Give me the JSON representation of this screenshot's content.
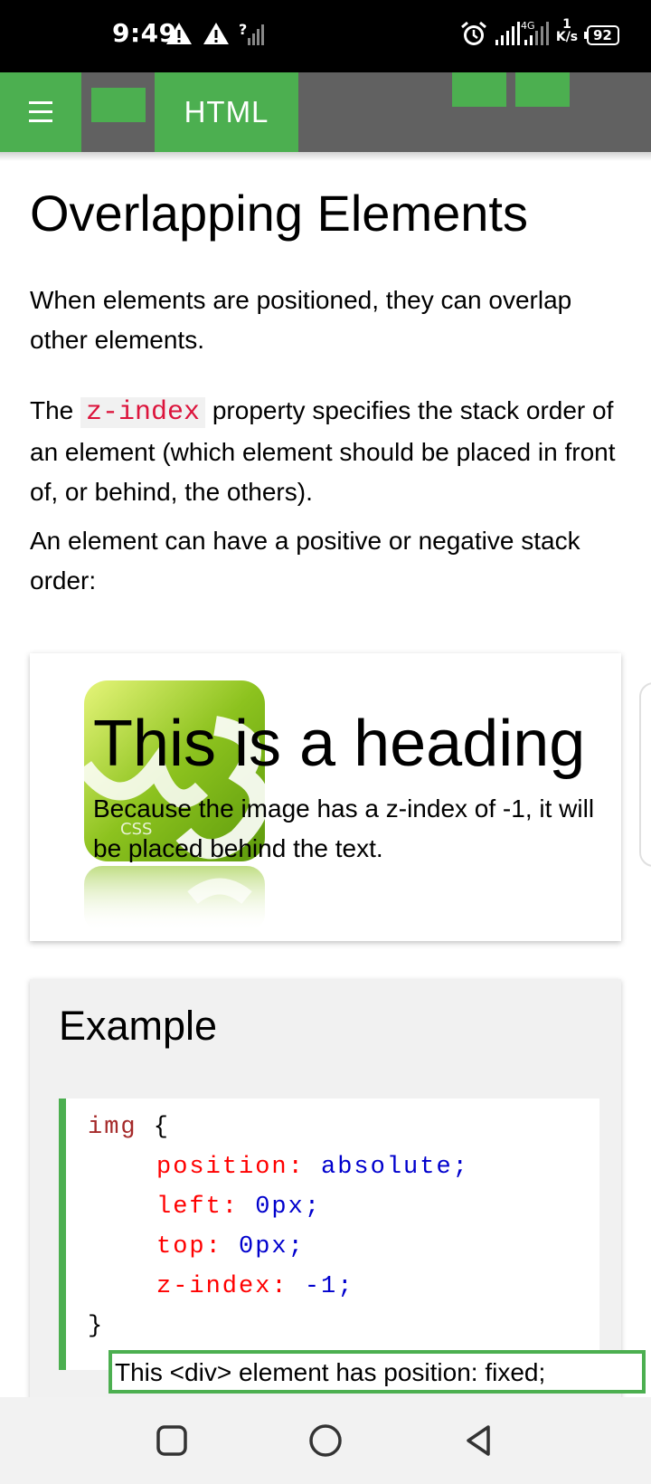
{
  "status_bar": {
    "time": "9:49",
    "network_speed_value": "1",
    "network_speed_unit": "K/s",
    "battery": "92",
    "icons": [
      "warning-icon",
      "warning-icon",
      "no-signal-icon",
      "alarm-icon",
      "signal-icon",
      "signal-icon",
      "battery-icon"
    ]
  },
  "nav": {
    "tab_label": "HTML",
    "accent_color": "#4CAF50",
    "bar_color": "#616161"
  },
  "page": {
    "title": "Overlapping Elements",
    "para1": "When elements are positioned, they can overlap other elements.",
    "para2_before": "The",
    "para2_code": "z-index",
    "para2_after": "property specifies the stack order of an element (which element should be placed in front of, or behind, the others).",
    "para3": "An element can have a positive or negative stack order:"
  },
  "demo": {
    "heading": "This is a heading",
    "text": "Because the image has a z-index of -1, it will be placed behind the text."
  },
  "example": {
    "title": "Example",
    "code": {
      "selector": "img",
      "open_brace": " {",
      "lines": [
        {
          "prop": "position:",
          "val": " absolute",
          "end": ";"
        },
        {
          "prop": "left:",
          "val": " 0px",
          "end": ";"
        },
        {
          "prop": "top:",
          "val": " 0px",
          "end": ";"
        },
        {
          "prop": "z-index:",
          "val": " -1",
          "end": ";"
        }
      ],
      "close_brace": "}"
    }
  },
  "fixed_div_text": "This <div> element has position: fixed;",
  "system_nav": {
    "buttons": [
      "recent-apps-icon",
      "home-icon",
      "back-icon"
    ]
  }
}
